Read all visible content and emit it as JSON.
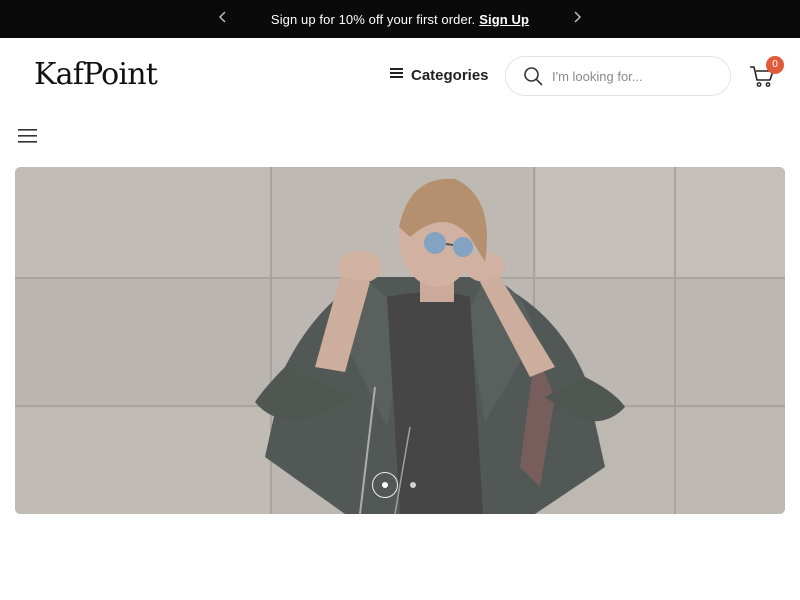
{
  "announcement": {
    "text": "Sign up for 10% off your first order.",
    "link_label": "Sign Up",
    "prev_icon": "chevron-left-icon",
    "next_icon": "chevron-right-icon"
  },
  "header": {
    "logo_text": "KafPoint",
    "categories_label": "Categories",
    "categories_icon": "menu-lines-icon",
    "search_placeholder": "I'm looking for...",
    "search_icon": "search-icon",
    "cart_icon": "shopping-cart-icon",
    "cart_count": "0"
  },
  "nav": {
    "menu_icon": "hamburger-menu-icon"
  },
  "hero": {
    "slides_count": 2,
    "active_slide": 1,
    "image_subject": "woman-in-leather-jacket"
  },
  "colors": {
    "announcement_bg": "#0a0a0a",
    "badge": "#e25a3c",
    "text": "#222222"
  }
}
